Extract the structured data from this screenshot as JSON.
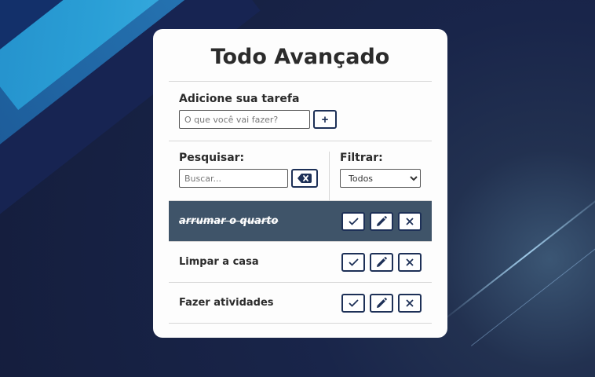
{
  "app": {
    "title": "Todo Avançado"
  },
  "add": {
    "label": "Adicione sua tarefa",
    "placeholder": "O que você vai fazer?",
    "button_icon": "plus-icon",
    "button_glyph": "+"
  },
  "search": {
    "label": "Pesquisar:",
    "placeholder": "Buscar...",
    "clear_icon": "backspace-icon"
  },
  "filter": {
    "label": "Filtrar:",
    "selected": "Todos",
    "options": [
      "Todos"
    ]
  },
  "todos": [
    {
      "text": "arrumar o quarto",
      "done": true
    },
    {
      "text": "Limpar a casa",
      "done": false
    },
    {
      "text": "Fazer atividades",
      "done": false
    }
  ],
  "icons": {
    "check": "check-icon",
    "edit": "pencil-icon",
    "remove": "close-icon"
  },
  "colors": {
    "accent": "#1d3057",
    "done_row": "#3f5469",
    "card": "#fdfdfd"
  }
}
